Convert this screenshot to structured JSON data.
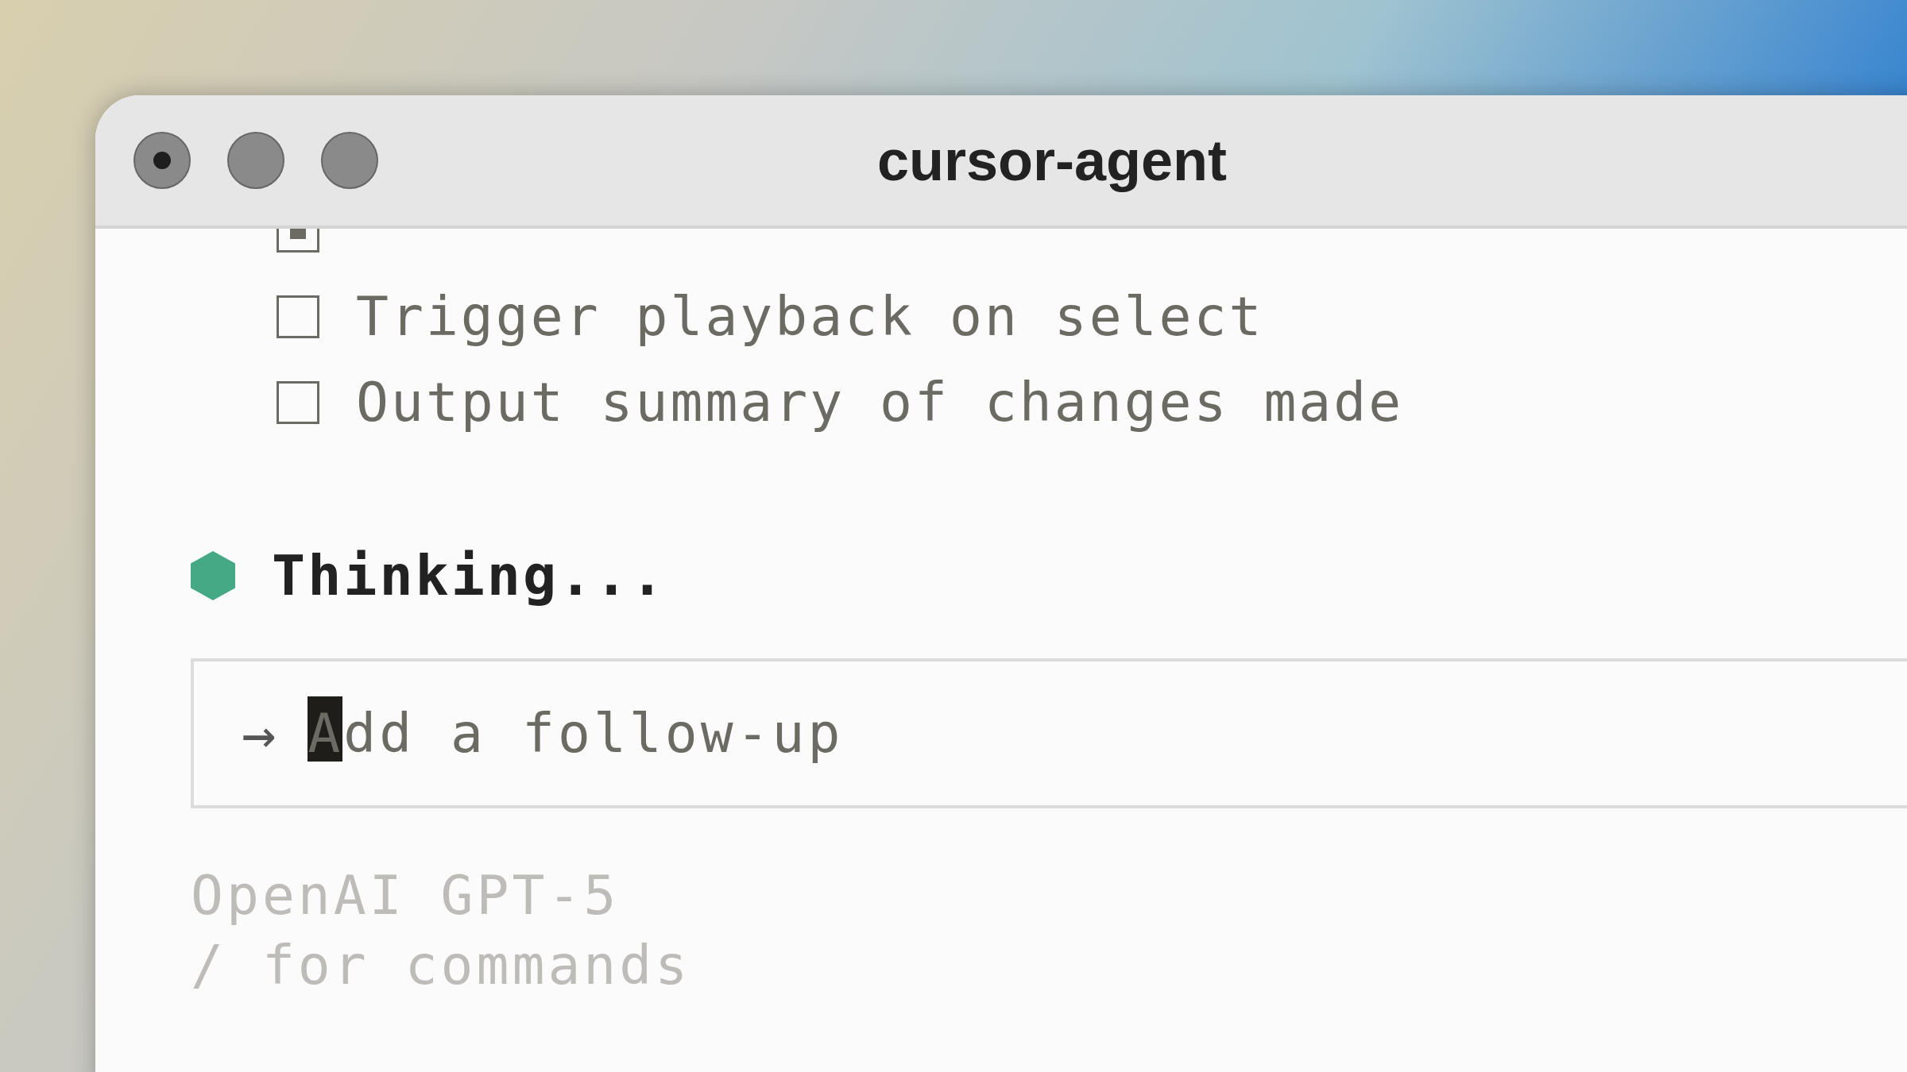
{
  "window": {
    "title": "cursor-agent"
  },
  "todos": [
    {
      "active": true
    },
    {
      "label": "Trigger playback on select",
      "active": false
    },
    {
      "label": "Output summary of changes made",
      "active": false
    }
  ],
  "status": {
    "text": "Thinking...",
    "color": "#45a985"
  },
  "input": {
    "prompt": "→",
    "placeholder": "Add a follow-up",
    "focused": true
  },
  "footer": [
    "OpenAI GPT-5",
    "/ for commands"
  ]
}
